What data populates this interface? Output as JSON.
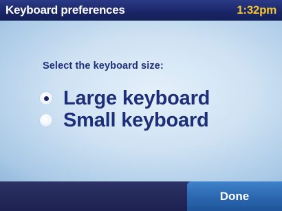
{
  "header": {
    "title": "Keyboard preferences",
    "clock": "1:32pm"
  },
  "main": {
    "prompt": "Select the keyboard size:",
    "options": [
      {
        "label": "Large keyboard",
        "selected": true
      },
      {
        "label": "Small keyboard",
        "selected": false
      }
    ]
  },
  "footer": {
    "done_label": "Done"
  },
  "colors": {
    "title_bar": "#1a2566",
    "clock": "#f2c230",
    "content_background": "#cfe2f3",
    "text": "#1e2f7a",
    "done_button": "#2a67b0"
  }
}
